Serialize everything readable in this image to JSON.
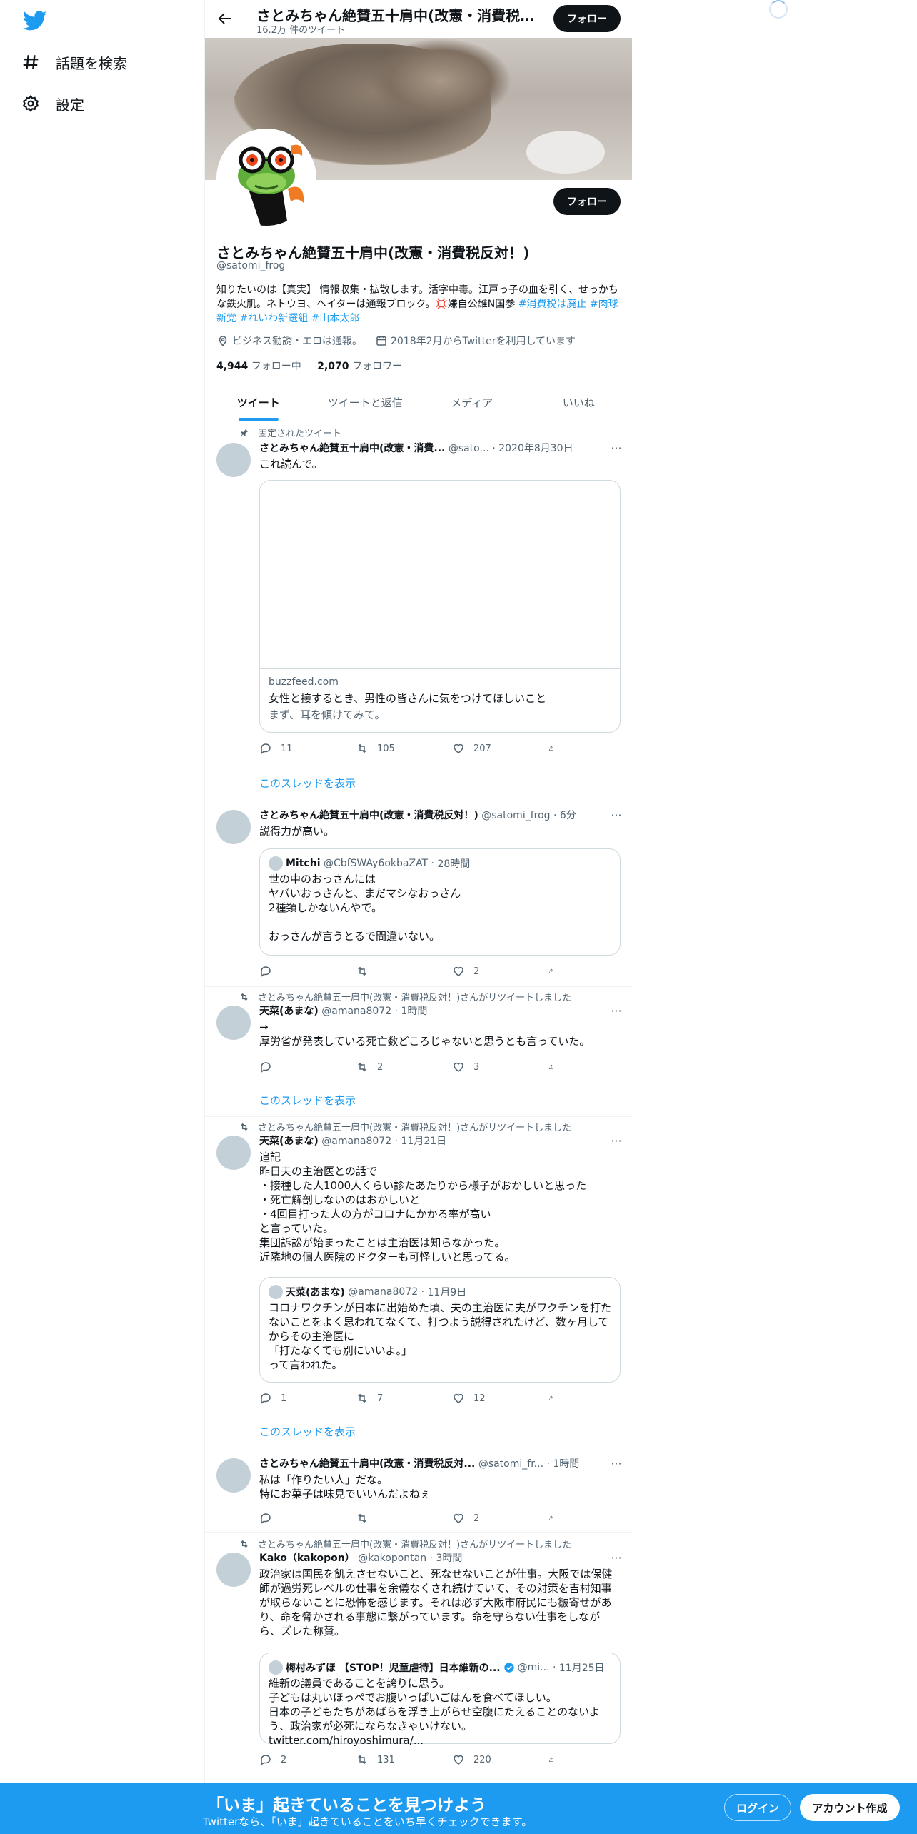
{
  "nav": {
    "explore_label": "話題を検索",
    "settings_label": "設定"
  },
  "header": {
    "title": "さとみちゃん絶賛五十肩中(改憲・消費税反...",
    "tweet_count": "16.2万 件のツイート",
    "follow_label": "フォロー"
  },
  "profile": {
    "follow_label": "フォロー",
    "name": "さとみちゃん絶賛五十肩中(改憲・消費税反対！)",
    "handle": "@satomi_frog",
    "bio_text": "知りたいのは【真実】 情報収集・拡散します。活字中毒。江戸っ子の血を引く、せっかちな鉄火肌。ネトウヨ、ヘイターは通報ブロック。💢嫌自公維N国参 ",
    "bio_tags": [
      "#消費税は廃止",
      "#肉球新党",
      "#れいわ新選組",
      "#山本太郎"
    ],
    "location": "ビジネス勧誘・エロは通報。",
    "joined": "2018年2月からTwitterを利用しています",
    "following_count": "4,944",
    "following_label": "フォロー中",
    "followers_count": "2,070",
    "followers_label": "フォロワー"
  },
  "tabs": [
    "ツイート",
    "ツイートと返信",
    "メディア",
    "いいね"
  ],
  "tweets": [
    {
      "context": "固定されたツイート",
      "name": "さとみちゃん絶賛五十肩中(改憲・消費...",
      "handle": "@sato...",
      "time": "2020年8月30日",
      "text": "これ読んで。",
      "card_domain": "buzzfeed.com",
      "card_title": "女性と接するとき、男性の皆さんに気をつけてほしいこと",
      "card_desc": "まず、耳を傾けてみて。",
      "replies": "11",
      "retweets": "105",
      "likes": "207",
      "thread_link": "このスレッドを表示"
    },
    {
      "name": "さとみちゃん絶賛五十肩中(改憲・消費税反対！)",
      "handle": "@satomi_frog",
      "time": "6分",
      "text": "説得力が高い。",
      "quote_name": "Mitchi",
      "quote_handle": "@CbfSWAy6okbaZAT",
      "quote_time": "28時間",
      "quote_text": "世の中のおっさんには\nヤバいおっさんと、まだマシなおっさん\n2種類しかないんやで。\n\nおっさんが言うとるで間違いない。",
      "replies": "",
      "retweets": "",
      "likes": "2"
    },
    {
      "context": "さとみちゃん絶賛五十肩中(改憲・消費税反対！)さんがリツイートしました",
      "name": "天菜(あまな)",
      "handle": "@amana8072",
      "time": "1時間",
      "text": "→\n厚労省が発表している死亡数どころじゃないと思うとも言っていた。",
      "replies": "",
      "retweets": "2",
      "likes": "3",
      "thread_link": "このスレッドを表示"
    },
    {
      "context": "さとみちゃん絶賛五十肩中(改憲・消費税反対！)さんがリツイートしました",
      "name": "天菜(あまな)",
      "handle": "@amana8072",
      "time": "11月21日",
      "text": "追記\n昨日夫の主治医との話で\n・接種した人1000人くらい診たあたりから様子がおかしいと思った\n・死亡解剖しないのはおかしいと\n・4回目打った人の方がコロナにかかる率が高い\nと言っていた。\n集団訴訟が始まったことは主治医は知らなかった。\n近隣地の個人医院のドクターも可怪しいと思ってる。",
      "quote_name": "天菜(あまな)",
      "quote_handle": "@amana8072",
      "quote_time": "11月9日",
      "quote_text": "コロナワクチンが日本に出始めた頃、夫の主治医に夫がワクチンを打たないことをよく思われてなくて、打つよう説得されたけど、数ヶ月してからその主治医に\n「打たなくても別にいいよ。」\nって言われた。",
      "replies": "1",
      "retweets": "7",
      "likes": "12",
      "thread_link": "このスレッドを表示"
    },
    {
      "name": "さとみちゃん絶賛五十肩中(改憲・消費税反対...",
      "handle": "@satomi_fr...",
      "time": "1時間",
      "text": "私は「作りたい人」だな。\n特にお菓子は味見でいいんだよねぇ",
      "replies": "",
      "retweets": "",
      "likes": "2"
    },
    {
      "context": "さとみちゃん絶賛五十肩中(改憲・消費税反対！)さんがリツイートしました",
      "name": "Kako（kakopon）",
      "handle": "@kakopontan",
      "time": "3時間",
      "text": "政治家は国民を飢えさせないこと、死なせないことが仕事。大阪では保健師が過労死レベルの仕事を余儀なくされ続けていて、その対策を吉村知事が取らないことに恐怖を感じます。それは必ず大阪市府民にも皺寄せがあり、命を脅かされる事態に繋がっています。命を守らない仕事をしながら、ズレた称賛。",
      "quote_name": "梅村みずほ 【STOP！児童虐待】日本維新の...",
      "quote_handle": "@mi...",
      "quote_time": "11月25日",
      "quote_text": "維新の議員であることを誇りに思う。\n子どもは丸いほっぺでお腹いっぱいごはんを食べてほしい。\n日本の子どもたちがあばらを浮き上がらせ空腹にたえることのないよう、政治家が必死にならなきゃいけない。 twitter.com/hiroyoshimura/...",
      "replies": "2",
      "retweets": "131",
      "likes": "220"
    }
  ],
  "bottom_bar": {
    "title": "「いま」起きていることを見つけよう",
    "subtitle": "Twitterなら、「いま」起きていることをいち早くチェックできます。",
    "login_label": "ログイン",
    "signup_label": "アカウント作成"
  },
  "colors": {
    "accent": "#1d9bf0",
    "text": "#0f1419",
    "secondary": "#536471"
  }
}
